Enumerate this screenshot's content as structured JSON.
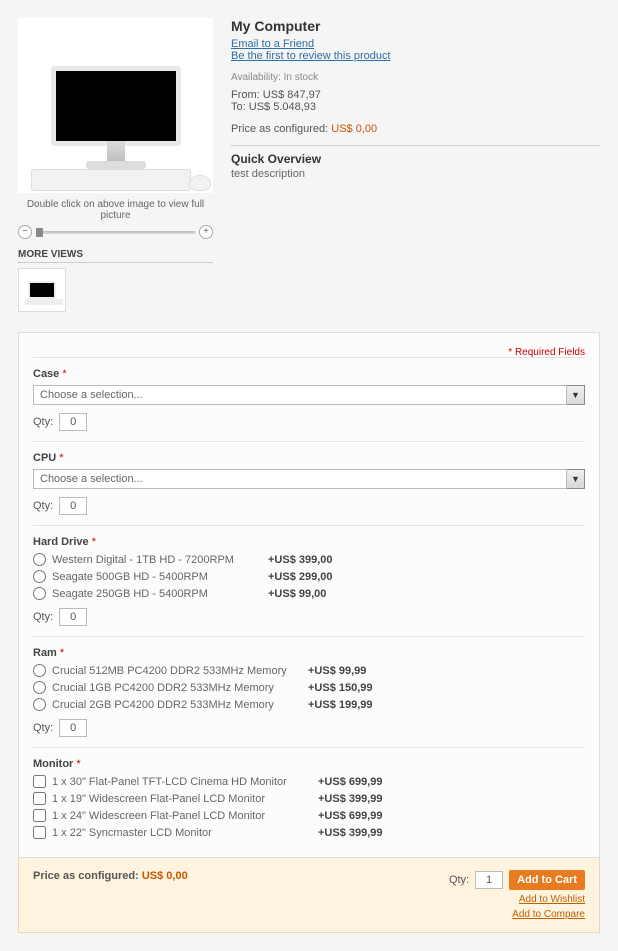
{
  "product": {
    "title": "My Computer",
    "email_link": "Email to a Friend",
    "review_link": "Be the first to review this product",
    "availability": "Availability: In stock",
    "price_from_label": "From:",
    "price_from": "US$ 847,97",
    "price_to_label": "To:",
    "price_to": "US$ 5.048,93",
    "configured_label": "Price as configured:",
    "configured_amount": "US$ 0,00",
    "overview_title": "Quick Overview",
    "overview_text": "test description"
  },
  "image": {
    "hint": "Double click on above image to view full picture",
    "more_views": "MORE VIEWS"
  },
  "options": {
    "required_note": "* Required Fields",
    "choose_selection": "Choose a selection...",
    "qty_label": "Qty:",
    "qty_value": "0",
    "case_label": "Case",
    "cpu_label": "CPU",
    "hard_drive": {
      "label": "Hard Drive",
      "items": [
        {
          "name": "Western Digital - 1TB HD - 7200RPM",
          "mod": "+US$ 399,00"
        },
        {
          "name": "Seagate 500GB HD - 5400RPM",
          "mod": "+US$ 299,00"
        },
        {
          "name": "Seagate 250GB HD - 5400RPM",
          "mod": "+US$ 99,00"
        }
      ]
    },
    "ram": {
      "label": "Ram",
      "items": [
        {
          "name": "Crucial 512MB PC4200 DDR2 533MHz Memory",
          "mod": "+US$ 99,99"
        },
        {
          "name": "Crucial 1GB PC4200 DDR2 533MHz Memory",
          "mod": "+US$ 150,99"
        },
        {
          "name": "Crucial 2GB PC4200 DDR2 533MHz Memory",
          "mod": "+US$ 199,99"
        }
      ]
    },
    "monitor": {
      "label": "Monitor",
      "items": [
        {
          "name": "1 x 30\" Flat-Panel TFT-LCD Cinema HD Monitor",
          "mod": "+US$ 699,99"
        },
        {
          "name": "1 x 19\" Widescreen Flat-Panel LCD Monitor",
          "mod": "+US$ 399,99"
        },
        {
          "name": "1 x 24\" Widescreen Flat-Panel LCD Monitor",
          "mod": "+US$ 699,99"
        },
        {
          "name": "1 x 22\" Syncmaster LCD Monitor",
          "mod": "+US$ 399,99"
        }
      ]
    }
  },
  "cart": {
    "configured_label": "Price as configured:",
    "configured_amount": "US$ 0,00",
    "qty_label": "Qty:",
    "qty_value": "1",
    "add_button": "Add to Cart",
    "wishlist_link": "Add to Wishlist",
    "compare_link": "Add to Compare"
  }
}
